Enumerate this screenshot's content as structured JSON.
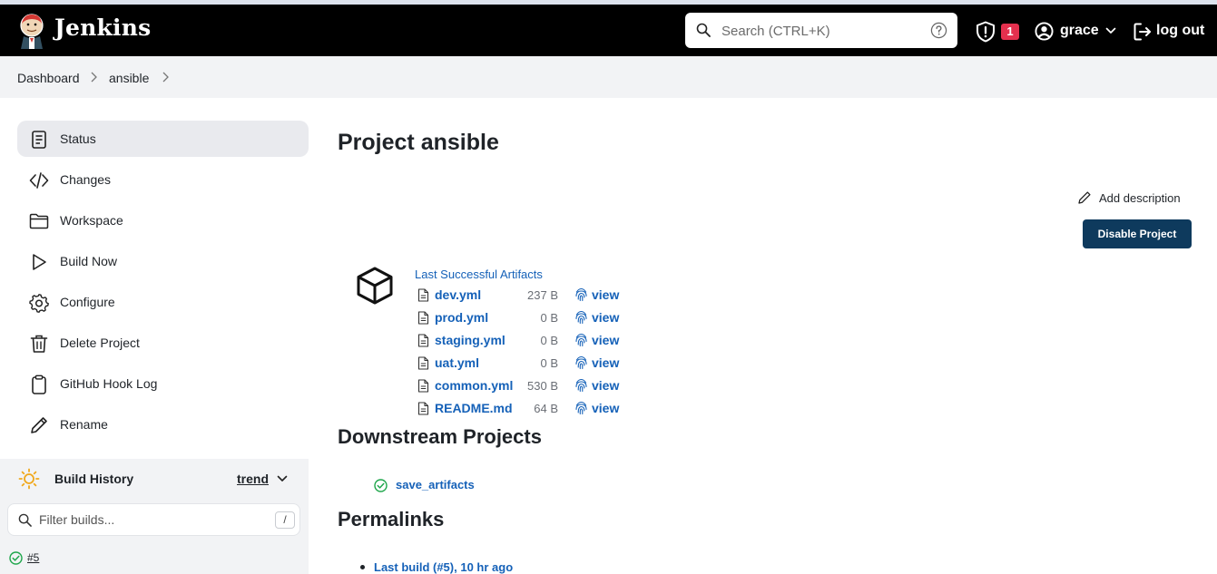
{
  "header": {
    "brand": "Jenkins",
    "search_placeholder": "Search (CTRL+K)",
    "alert_count": "1",
    "user": "grace",
    "logout": "log out"
  },
  "breadcrumb": [
    "Dashboard",
    "ansible"
  ],
  "sidebar": {
    "items": [
      {
        "label": "Status",
        "icon": "status-icon"
      },
      {
        "label": "Changes",
        "icon": "code-icon"
      },
      {
        "label": "Workspace",
        "icon": "folder-icon"
      },
      {
        "label": "Build Now",
        "icon": "play-icon"
      },
      {
        "label": "Configure",
        "icon": "gear-icon"
      },
      {
        "label": "Delete Project",
        "icon": "trash-icon"
      },
      {
        "label": "GitHub Hook Log",
        "icon": "clipboard-icon"
      },
      {
        "label": "Rename",
        "icon": "pencil-icon"
      }
    ]
  },
  "build_history": {
    "title": "Build History",
    "trend": "trend",
    "filter_placeholder": "Filter builds...",
    "filter_key": "/",
    "builds": [
      {
        "label": "#5",
        "status": "success"
      }
    ]
  },
  "main": {
    "title": "Project ansible",
    "add_description": "Add description",
    "disable_button": "Disable Project",
    "artifacts": {
      "title": "Last Successful Artifacts",
      "view_label": "view",
      "files": [
        {
          "name": "dev.yml",
          "size": "237 B"
        },
        {
          "name": "prod.yml",
          "size": "0 B"
        },
        {
          "name": "staging.yml",
          "size": "0 B"
        },
        {
          "name": "uat.yml",
          "size": "0 B"
        },
        {
          "name": "common.yml",
          "size": "530 B"
        },
        {
          "name": "README.md",
          "size": "64 B"
        }
      ]
    },
    "downstream": {
      "title": "Downstream Projects",
      "projects": [
        "save_artifacts"
      ]
    },
    "permalinks": {
      "title": "Permalinks",
      "items": [
        "Last build (#5), 10 hr ago"
      ]
    }
  },
  "colors": {
    "header_bg": "#000000",
    "primary_button": "#0e3a5d",
    "link": "#1561b8",
    "alert_badge": "#e4304e",
    "success": "#1ea64b",
    "sun": "#f0a81c"
  }
}
